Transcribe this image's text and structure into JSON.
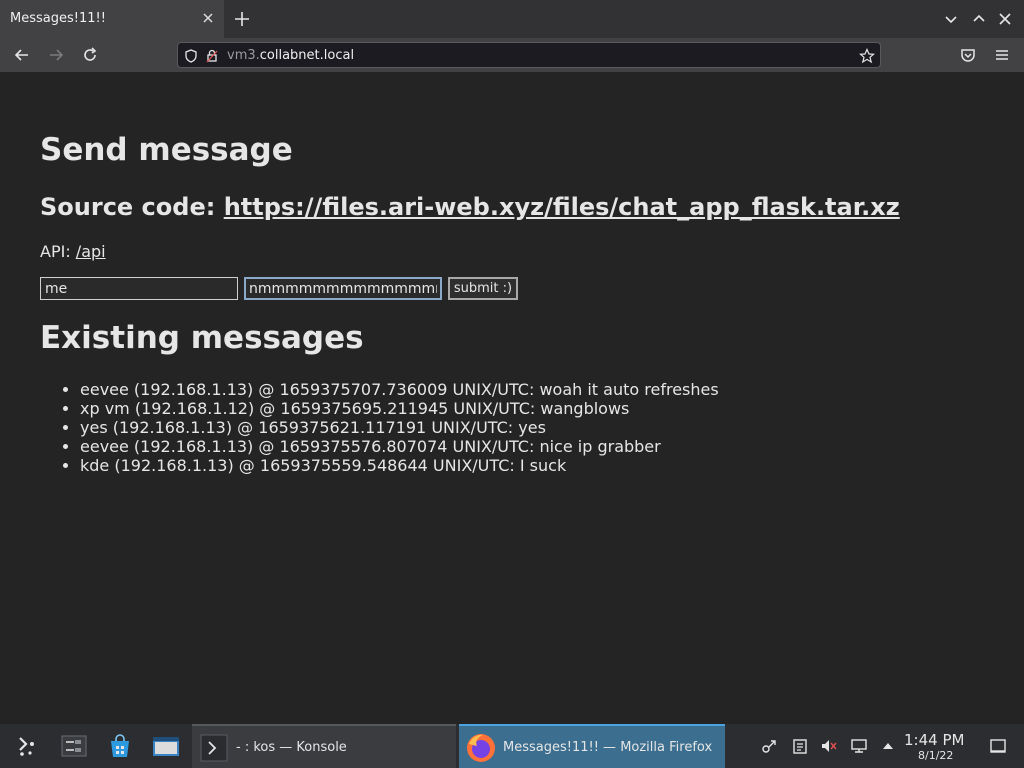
{
  "browser": {
    "tab_title": "Messages!11!!",
    "url_scheme_part": "vm3.",
    "url_host": "collabnet.local"
  },
  "page": {
    "title": "Send message",
    "source_label": "Source code: ",
    "source_link": "https://files.ari-web.xyz/files/chat_app_flask.tar.xz",
    "api_label": "API: ",
    "api_link": "/api",
    "name_value": "me",
    "message_value": "nmmmmmmmmmmmmmmm",
    "submit_label": "submit :)",
    "existing_title": "Existing messages",
    "messages": [
      "eevee (192.168.1.13) @ 1659375707.736009 UNIX/UTC: woah it auto refreshes",
      "xp vm (192.168.1.12) @ 1659375695.211945 UNIX/UTC: wangblows",
      "yes (192.168.1.13) @ 1659375621.117191 UNIX/UTC: yes",
      "eevee (192.168.1.13) @ 1659375576.807074 UNIX/UTC: nice ip grabber",
      "kde (192.168.1.13) @ 1659375559.548644 UNIX/UTC: I suck"
    ]
  },
  "taskbar": {
    "konsole_label": "- : kos — Konsole",
    "firefox_label": "Messages!11!! — Mozilla Firefox",
    "clock_time": "1:44 PM",
    "clock_date": "8/1/22"
  },
  "icons": {
    "app_launcher": "kde-launcher-icon",
    "task_manager": "pager-icon",
    "discover": "store-bag-icon",
    "dolphin": "folder-icon",
    "konsole": "terminal-icon",
    "firefox": "firefox-icon"
  },
  "colors": {
    "page_bg": "#242424",
    "text": "#e6e6e6",
    "active_task": "#3b6e8f",
    "focus_border": "#8aa8c8"
  }
}
